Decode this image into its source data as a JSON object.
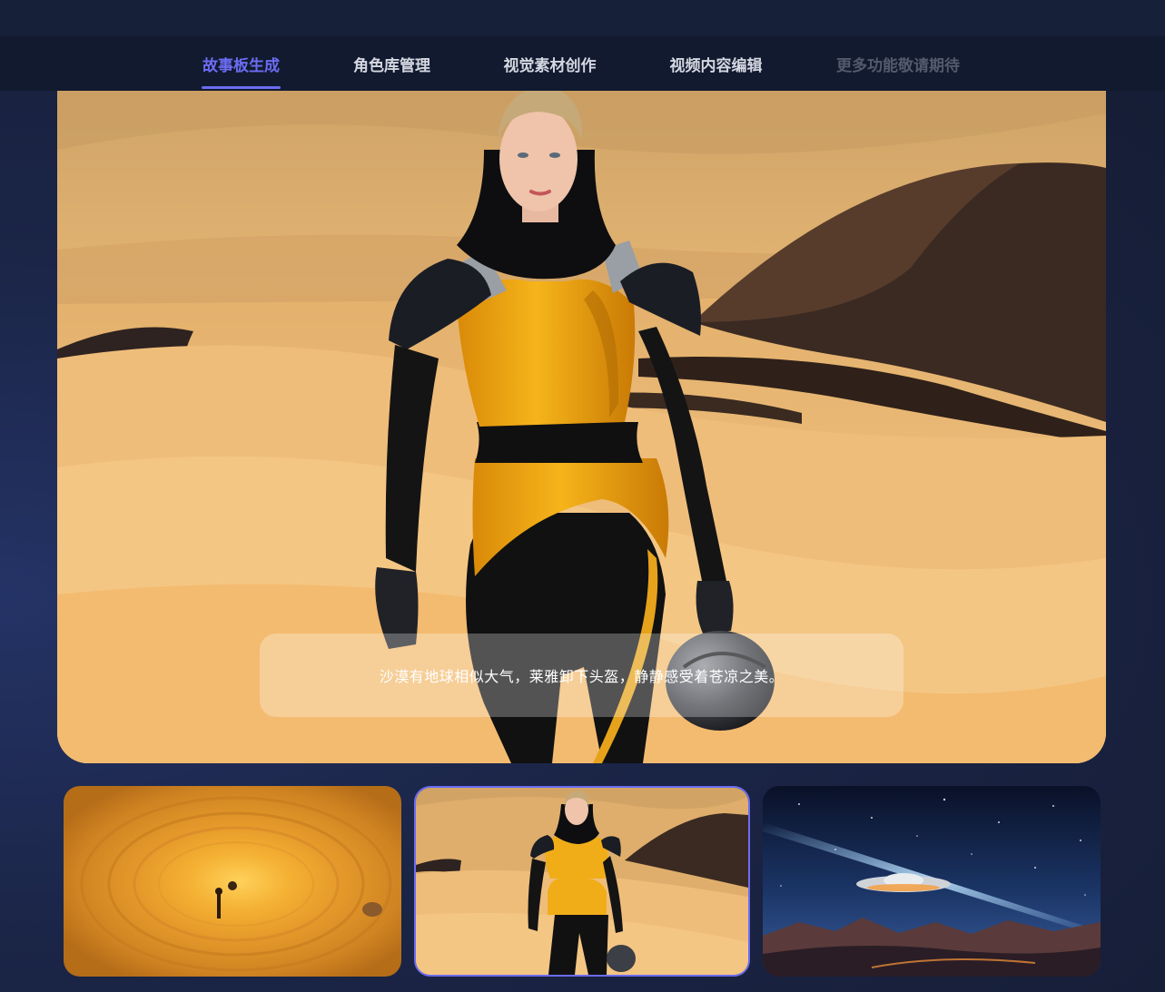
{
  "nav": {
    "tabs": [
      {
        "label": "故事板生成",
        "state": "active"
      },
      {
        "label": "角色库管理",
        "state": "normal"
      },
      {
        "label": "视觉素材创作",
        "state": "normal"
      },
      {
        "label": "视频内容编辑",
        "state": "normal"
      },
      {
        "label": "更多功能敬请期待",
        "state": "disabled"
      }
    ],
    "active_color": "#6c6cf2"
  },
  "stage": {
    "caption": "沙漠有地球相似大气，莱雅卸下头盔，静静感受着苍凉之美。",
    "image": "woman-in-yellow-black-armor-walking-in-desert-holding-helmet"
  },
  "thumbnails": [
    {
      "image": "figure-standing-in-circular-sand-crater",
      "selected": false
    },
    {
      "image": "woman-in-armor-walking-in-desert",
      "selected": true
    },
    {
      "image": "flying-saucer-over-night-mountains",
      "selected": false
    }
  ]
}
